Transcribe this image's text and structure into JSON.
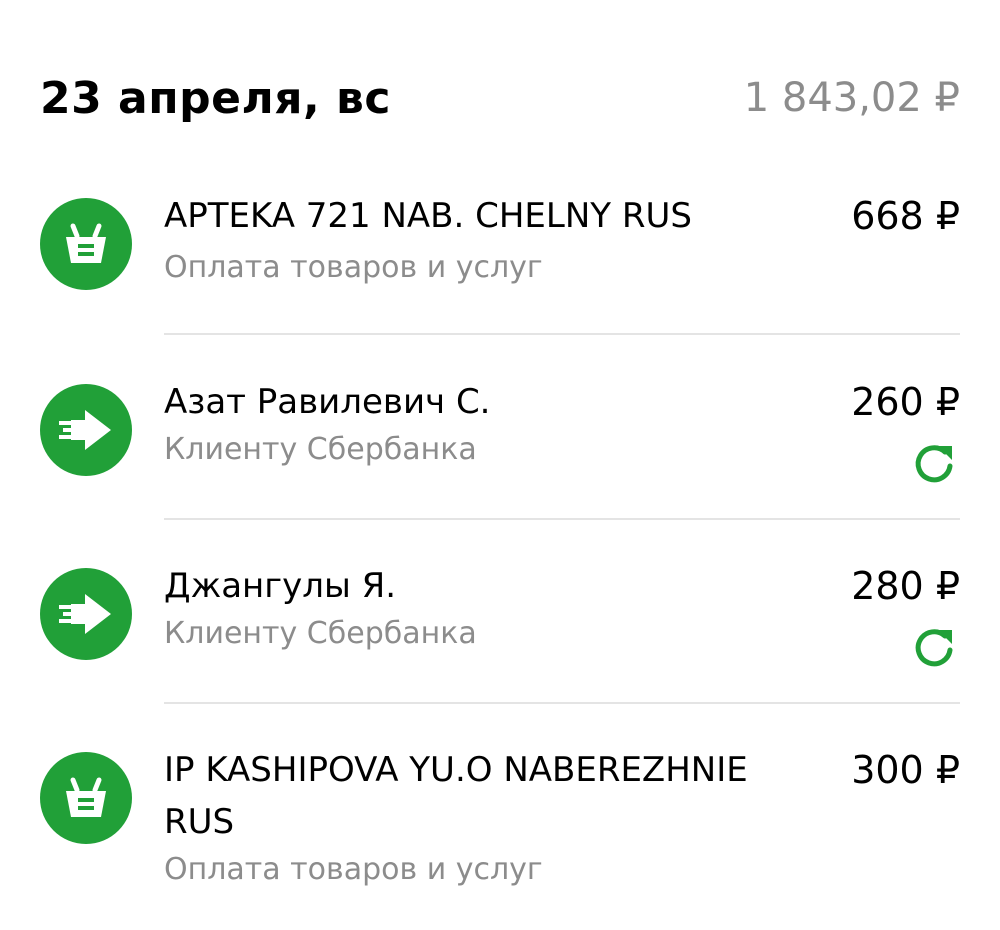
{
  "day": {
    "title": "23 апреля, вс",
    "total": "1 843,02 ₽"
  },
  "transactions": [
    {
      "title": "APTEKA 721 NAB. CHELNY RUS",
      "subtitle": "Оплата товаров и услуг",
      "amount": "668 ₽",
      "icon": "shopping-basket-icon",
      "repeat": false
    },
    {
      "title": "Азат Равилевич С.",
      "subtitle": "Клиенту Сбербанка",
      "amount": "260 ₽",
      "icon": "transfer-arrow-icon",
      "repeat": true
    },
    {
      "title": "Джангулы Я.",
      "subtitle": "Клиенту Сбербанка",
      "amount": "280 ₽",
      "icon": "transfer-arrow-icon",
      "repeat": true
    },
    {
      "title": "IP KASHIPOVA YU.O NABEREZHNIE RUS",
      "subtitle": "Оплата товаров и услуг",
      "amount": "300 ₽",
      "icon": "shopping-basket-icon",
      "repeat": false
    }
  ],
  "colors": {
    "accent": "#21a038",
    "secondary_text": "#8c8c8c",
    "divider": "#e4e4e4"
  }
}
